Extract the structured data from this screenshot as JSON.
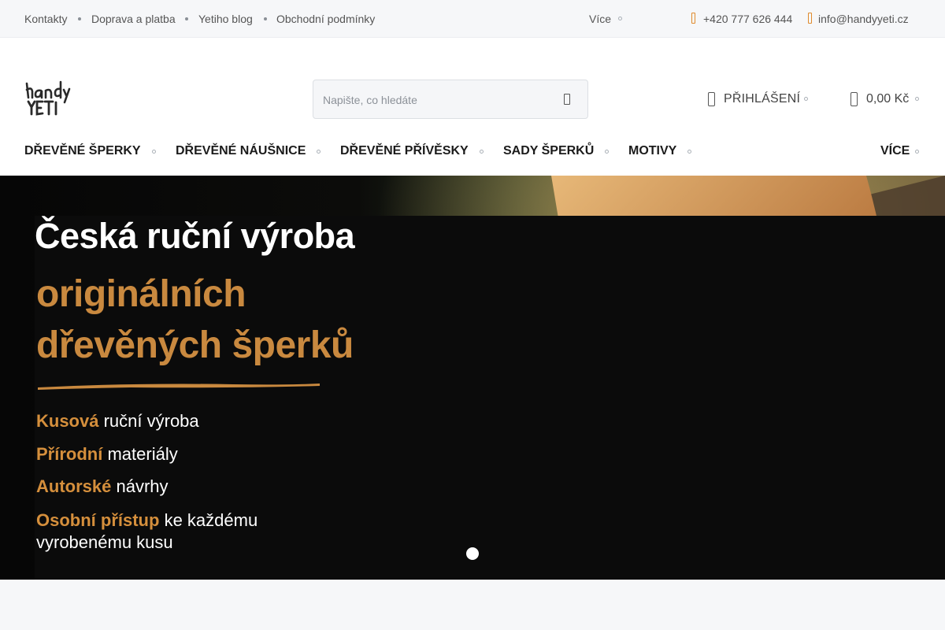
{
  "topbar": {
    "links": [
      "Kontakty",
      "Doprava a platba",
      "Yetiho blog",
      "Obchodní podmínky"
    ],
    "more": "Více",
    "phone": "+420 777 626 444",
    "email": "info@handyyeti.cz"
  },
  "header": {
    "logo_text": "handy YETI",
    "search_placeholder": "Napište, co hledáte",
    "login": "PŘIHLÁŠENÍ",
    "cart": "0,00 Kč"
  },
  "nav": {
    "items": [
      "DŘEVĚNÉ ŠPERKY",
      "DŘEVĚNÉ NÁUŠNICE",
      "DŘEVĚNÉ PŘÍVĚSKY",
      "SADY ŠPERKŮ",
      "MOTIVY"
    ],
    "more": "VÍCE"
  },
  "hero": {
    "headline": "Česká ruční výroba",
    "subline1": "originálních",
    "subline2": "dřevěných šperků",
    "features": [
      {
        "bold": "Kusová",
        "rest": " ruční výroba"
      },
      {
        "bold": "Přírodní",
        "rest": " materiály"
      },
      {
        "bold": "Autorské",
        "rest": " návrhy"
      },
      {
        "bold": "Osobní přístup",
        "rest": " ke každému"
      }
    ],
    "feature_continuation": "vyrobenému kusu",
    "slide_indicator": {
      "total": 1,
      "active": 1
    }
  },
  "colors": {
    "accent": "#c9893f",
    "topbar_bg": "#f6f7f9",
    "hero_bg": "#0b0b0b"
  }
}
